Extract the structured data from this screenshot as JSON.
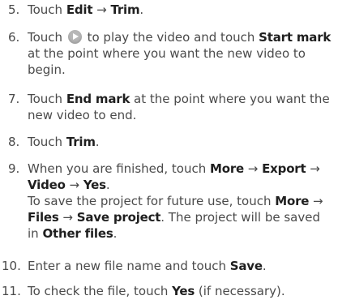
{
  "steps": [
    {
      "number": "5.",
      "lines": [
        [
          {
            "t": "Touch "
          },
          {
            "t": "Edit",
            "b": true
          },
          {
            "t": " → "
          },
          {
            "t": "Trim",
            "b": true
          },
          {
            "t": "."
          }
        ]
      ]
    },
    {
      "number": "6.",
      "lines": [
        [
          {
            "t": "Touch "
          },
          {
            "icon": "play-icon"
          },
          {
            "t": " to play the video and touch "
          },
          {
            "t": "Start mark",
            "b": true
          }
        ],
        [
          {
            "t": "at the point where you want the new video to"
          }
        ],
        [
          {
            "t": "begin."
          }
        ]
      ]
    },
    {
      "number": "7.",
      "lines": [
        [
          {
            "t": "Touch "
          },
          {
            "t": "End mark",
            "b": true
          },
          {
            "t": " at the point where you want the"
          }
        ],
        [
          {
            "t": "new video to end."
          }
        ]
      ]
    },
    {
      "number": "8.",
      "lines": [
        [
          {
            "t": "Touch "
          },
          {
            "t": "Trim",
            "b": true
          },
          {
            "t": "."
          }
        ]
      ]
    },
    {
      "number": "9.",
      "lines": [
        [
          {
            "t": "When you are finished, touch "
          },
          {
            "t": "More",
            "b": true
          },
          {
            "t": " → "
          },
          {
            "t": "Export",
            "b": true
          },
          {
            "t": " →"
          }
        ],
        [
          {
            "t": "Video",
            "b": true
          },
          {
            "t": " → "
          },
          {
            "t": "Yes",
            "b": true
          },
          {
            "t": "."
          }
        ],
        [
          {
            "t": "To save the project for future use, touch "
          },
          {
            "t": "More",
            "b": true
          },
          {
            "t": " →"
          }
        ],
        [
          {
            "t": "Files",
            "b": true
          },
          {
            "t": " → "
          },
          {
            "t": "Save project",
            "b": true
          },
          {
            "t": ". The project will be saved"
          }
        ],
        [
          {
            "t": "in "
          },
          {
            "t": "Other files",
            "b": true
          },
          {
            "t": "."
          }
        ]
      ]
    },
    {
      "number": "10.",
      "lines": [
        [
          {
            "t": "Enter a new file name and touch "
          },
          {
            "t": "Save",
            "b": true
          },
          {
            "t": "."
          }
        ]
      ]
    },
    {
      "number": "11.",
      "lines": [
        [
          {
            "t": "To check the file, touch "
          },
          {
            "t": "Yes",
            "b": true
          },
          {
            "t": " (if necessary)."
          }
        ]
      ]
    }
  ]
}
